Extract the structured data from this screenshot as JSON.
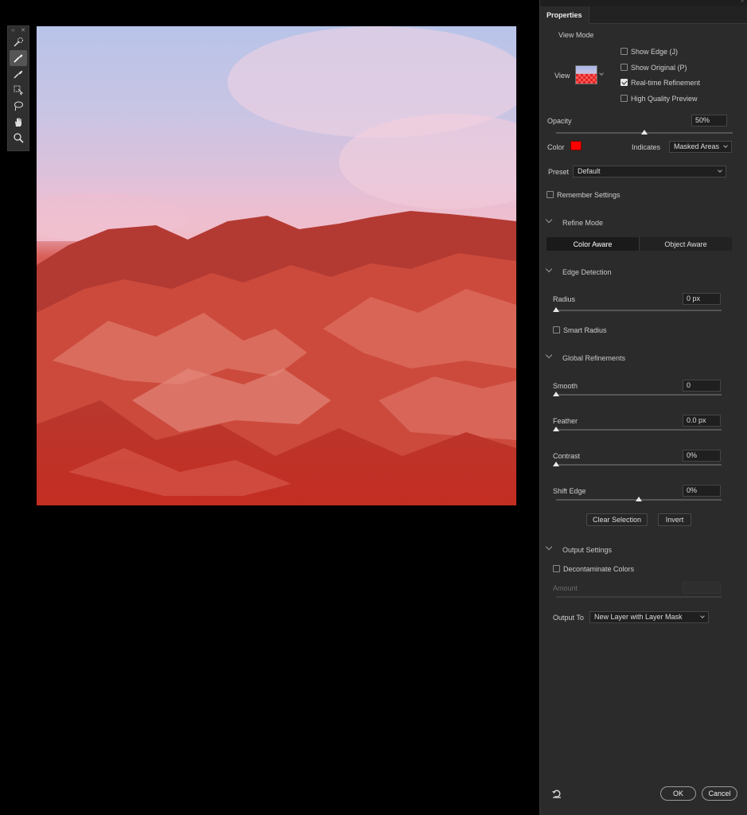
{
  "panel": {
    "tab_title": "Properties"
  },
  "view_mode": {
    "section_title": "View Mode",
    "view_label": "View",
    "options": [
      {
        "label": "Show Edge (J)",
        "checked": false
      },
      {
        "label": "Show Original (P)",
        "checked": false
      },
      {
        "label": "Real-time Refinement",
        "checked": true
      },
      {
        "label": "High Quality Preview",
        "checked": false
      }
    ]
  },
  "opacity": {
    "label": "Opacity",
    "value": "50%",
    "level": 0.5
  },
  "color": {
    "label": "Color",
    "swatch": "#ff0000",
    "indicates_label": "Indicates",
    "indicates_value": "Masked Areas"
  },
  "preset": {
    "label": "Preset",
    "value": "Default"
  },
  "remember_settings": {
    "label": "Remember Settings",
    "checked": false
  },
  "refine_mode": {
    "section_title": "Refine Mode",
    "options": [
      "Color Aware",
      "Object Aware"
    ],
    "active": "Color Aware"
  },
  "edge_detection": {
    "section_title": "Edge Detection",
    "radius_label": "Radius",
    "radius_value": "0 px",
    "radius_level": 0,
    "smart_radius_label": "Smart Radius",
    "smart_radius_checked": false
  },
  "global_refinements": {
    "section_title": "Global Refinements",
    "smooth_label": "Smooth",
    "smooth_value": "0",
    "smooth_level": 0,
    "feather_label": "Feather",
    "feather_value": "0.0 px",
    "feather_level": 0,
    "contrast_label": "Contrast",
    "contrast_value": "0%",
    "contrast_level": 0,
    "shift_edge_label": "Shift Edge",
    "shift_edge_value": "0%",
    "shift_edge_level": 0.5,
    "clear_selection_label": "Clear Selection",
    "invert_label": "Invert"
  },
  "output_settings": {
    "section_title": "Output Settings",
    "decontaminate_label": "Decontaminate Colors",
    "decontaminate_checked": false,
    "amount_label": "Amount",
    "output_to_label": "Output To",
    "output_to_value": "New Layer with Layer Mask"
  },
  "footer": {
    "ok_label": "OK",
    "cancel_label": "Cancel"
  },
  "tools": [
    {
      "icon": "quick-selection-brush-icon",
      "active": false
    },
    {
      "icon": "refine-edge-brush-icon",
      "active": true
    },
    {
      "icon": "brush-icon",
      "active": false
    },
    {
      "icon": "object-selection-icon",
      "active": false
    },
    {
      "icon": "lasso-icon",
      "active": false
    },
    {
      "icon": "hand-icon",
      "active": false
    },
    {
      "icon": "zoom-icon",
      "active": false
    }
  ]
}
